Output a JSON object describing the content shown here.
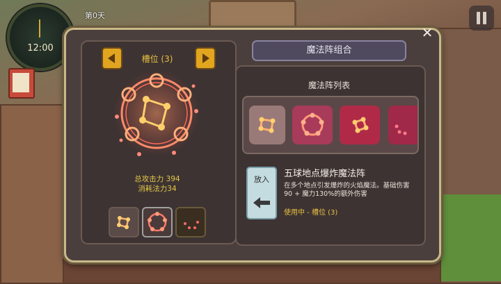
{
  "hud": {
    "clock_time": "12:00",
    "day_label": "第0天"
  },
  "left": {
    "slot_title": "槽位 (3)",
    "attack_stat": "总攻击力 394",
    "mana_stat": "消耗法力34",
    "slots": [
      {
        "icon": "square-rune-icon",
        "state": "filled"
      },
      {
        "icon": "ring-rune-icon",
        "state": "selected"
      },
      {
        "icon": "dots-rune-icon",
        "state": "empty"
      }
    ]
  },
  "right": {
    "title": "魔法阵组合",
    "list_title": "魔法阵列表",
    "list_items": [
      {
        "icon": "square-rune-icon"
      },
      {
        "icon": "ring-rune-icon"
      },
      {
        "icon": "diamond-rune-icon"
      },
      {
        "icon": "dots-rune-icon"
      }
    ],
    "put_label": "放入",
    "spell_name": "五球地点爆炸魔法阵",
    "spell_desc": "在多个地点引发爆炸的火焰魔法。基础伤害 90 + 魔力130%的额外伤害",
    "spell_status": "使用中 - 槽位 (3)"
  },
  "colors": {
    "accent_gold": "#e2a51f",
    "panel_bg": "#3d3332",
    "rune_glow": "#ff7a5a"
  }
}
